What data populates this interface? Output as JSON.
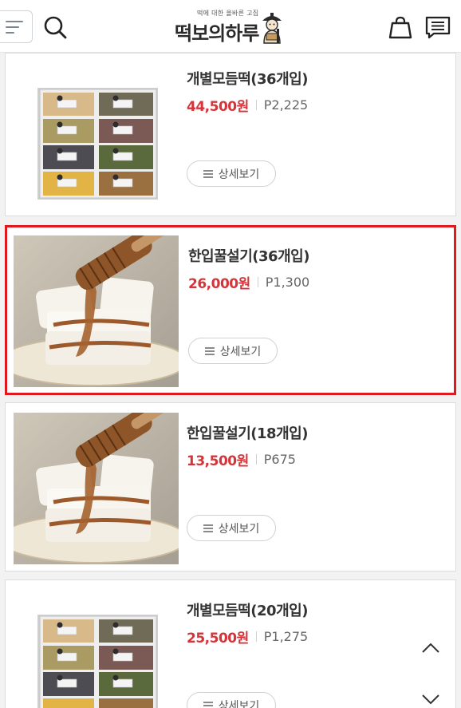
{
  "header": {
    "logo_subtitle": "떡에 대한 올바른 고집",
    "logo_text": "떡보의하루"
  },
  "products": [
    {
      "name": "개별모듬떡(36개입)",
      "price": "44,500원",
      "point": "P2,225",
      "detail_label": "상세보기",
      "image": "assorted-rice-cake-box",
      "selected": false
    },
    {
      "name": "한입꿀설기(36개입)",
      "price": "26,000원",
      "point": "P1,300",
      "detail_label": "상세보기",
      "image": "honey-rice-cake",
      "selected": true
    },
    {
      "name": "한입꿀설기(18개입)",
      "price": "13,500원",
      "point": "P675",
      "detail_label": "상세보기",
      "image": "honey-rice-cake",
      "selected": false
    },
    {
      "name": "개별모듬떡(20개입)",
      "price": "25,500원",
      "point": "P1,275",
      "detail_label": "상세보기",
      "image": "assorted-rice-cake-box",
      "selected": false
    }
  ],
  "colors": {
    "price": "#d3353a",
    "selection_border": "#e0191f"
  }
}
